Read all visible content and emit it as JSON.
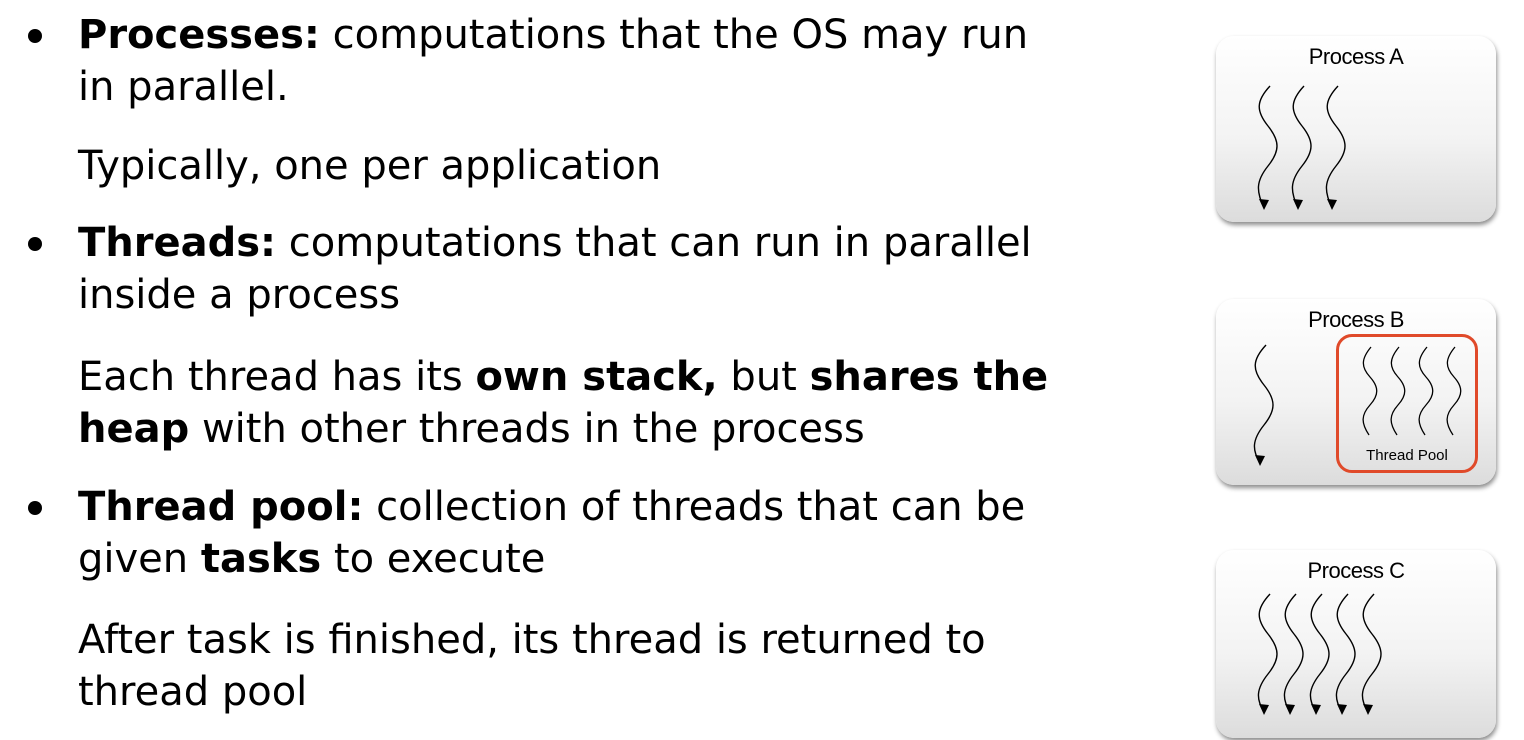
{
  "bullets": [
    {
      "term": "Processes:",
      "text": " computations that the OS may run",
      "text2": "in parallel.",
      "note": "Typically, one per application"
    },
    {
      "term": "Threads:",
      "text": " computations that can run in parallel",
      "text2": "inside a process",
      "note": {
        "a": "Each thread has its ",
        "b": "own stack,",
        "c": " but ",
        "d": "shares the",
        "e": "heap",
        "f": " with other threads in the process"
      }
    },
    {
      "term": "Thread pool:",
      "text": " collection of threads that can be",
      "text2a": "given ",
      "text2b": "tasks",
      "text2c": " to execute",
      "note": "After task is finished, its thread is returned to",
      "note2": "thread pool"
    }
  ],
  "diagram": {
    "processes": [
      {
        "title": "Process A",
        "thread_count": 3
      },
      {
        "title": "Process B",
        "thread_count": 1,
        "pool_thread_count": 4,
        "pool_label": "Thread Pool"
      },
      {
        "title": "Process C",
        "thread_count": 5
      }
    ],
    "colors": {
      "pool_border": "#e04a2a",
      "thread_line": "#000000"
    }
  }
}
